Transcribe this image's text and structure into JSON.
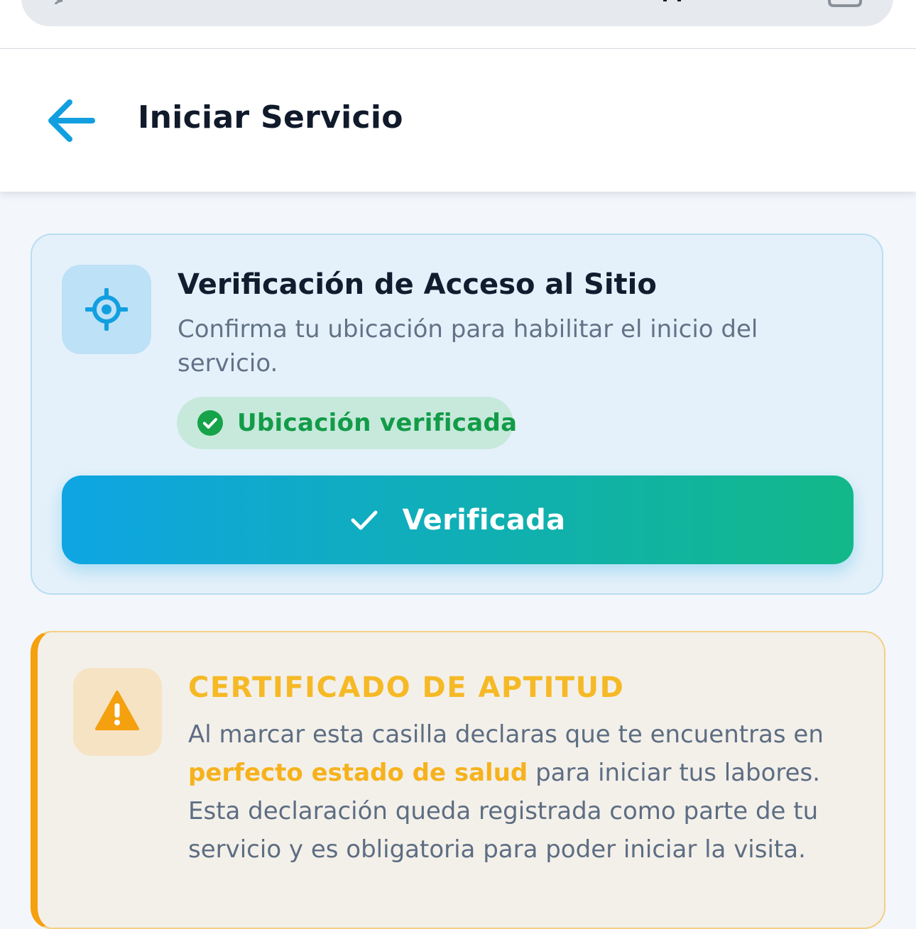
{
  "header": {
    "title": "Iniciar Servicio"
  },
  "verification": {
    "title": "Verificación de Acceso al Sitio",
    "description": "Confirma tu ubicación para habilitar el inicio del servicio.",
    "status": "Ubicación verificada",
    "button_label": "Verificada",
    "icon": "crosshair-icon"
  },
  "certificate": {
    "title": "CERTIFICADO DE APTITUD",
    "body_part1": "Al marcar esta casilla declaras que te encuentras en ",
    "body_highlight": "perfecto estado de salud",
    "body_part2": " para iniciar tus labores. Esta declaración queda registrada como parte de tu servicio y es obligatoria para poder iniciar la visita.",
    "icon": "warning-icon"
  },
  "colors": {
    "accent": "#0ea5e3",
    "success": "#139b48",
    "warning": "#f5a00e"
  }
}
